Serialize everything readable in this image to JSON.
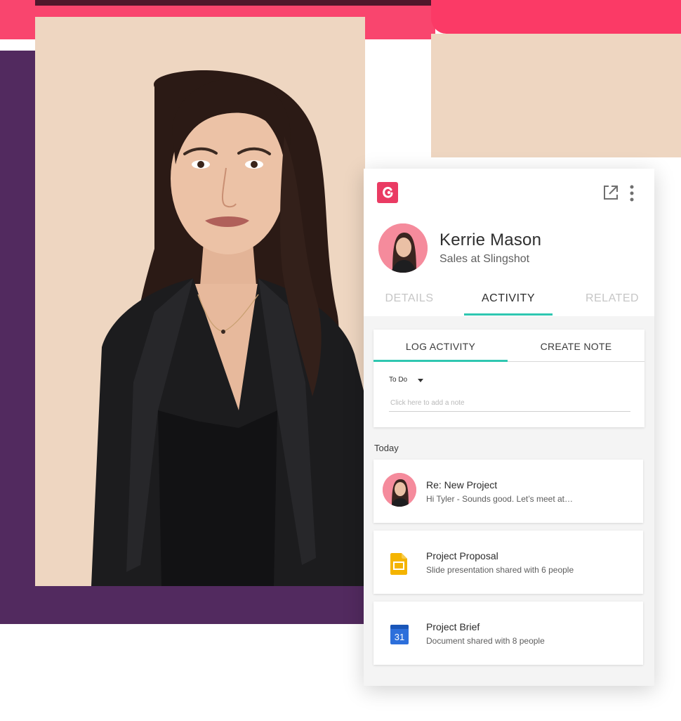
{
  "contact": {
    "name": "Kerrie Mason",
    "title": "Sales at Slingshot"
  },
  "header": {
    "logo_icon": "copper-logo-icon",
    "actions": [
      {
        "icon": "external-link-icon"
      },
      {
        "icon": "more-vertical-icon"
      }
    ]
  },
  "tabs": [
    {
      "label": "DETAILS",
      "active": false
    },
    {
      "label": "ACTIVITY",
      "active": true
    },
    {
      "label": "RELATED",
      "active": false
    }
  ],
  "log_panel": {
    "tabs": [
      {
        "label": "LOG ACTIVITY",
        "active": true
      },
      {
        "label": "CREATE NOTE",
        "active": false
      }
    ],
    "type_select": "To Do",
    "note_placeholder": "Click here to add a note"
  },
  "timeline": {
    "group_label": "Today",
    "items": [
      {
        "title": "Re: New Project",
        "subtitle": "Hi Tyler -  Sounds good. Let’s meet at…",
        "icon": "avatar"
      },
      {
        "title": "Project Proposal",
        "subtitle": "Slide presentation shared with 6 people",
        "icon": "google-slides-icon"
      },
      {
        "title": "Project Brief",
        "subtitle": "Document shared with 8 people",
        "icon": "google-calendar-icon",
        "icon_text": "31"
      }
    ]
  },
  "colors": {
    "accent": "#2fc7b1",
    "brand": "#ea3b63",
    "pink_bar": "#f9456e",
    "purple_block": "#522a5f",
    "peach_background": "#eed6c1",
    "slides_yellow": "#f4b400",
    "calendar_blue": "#2d6fdb"
  }
}
